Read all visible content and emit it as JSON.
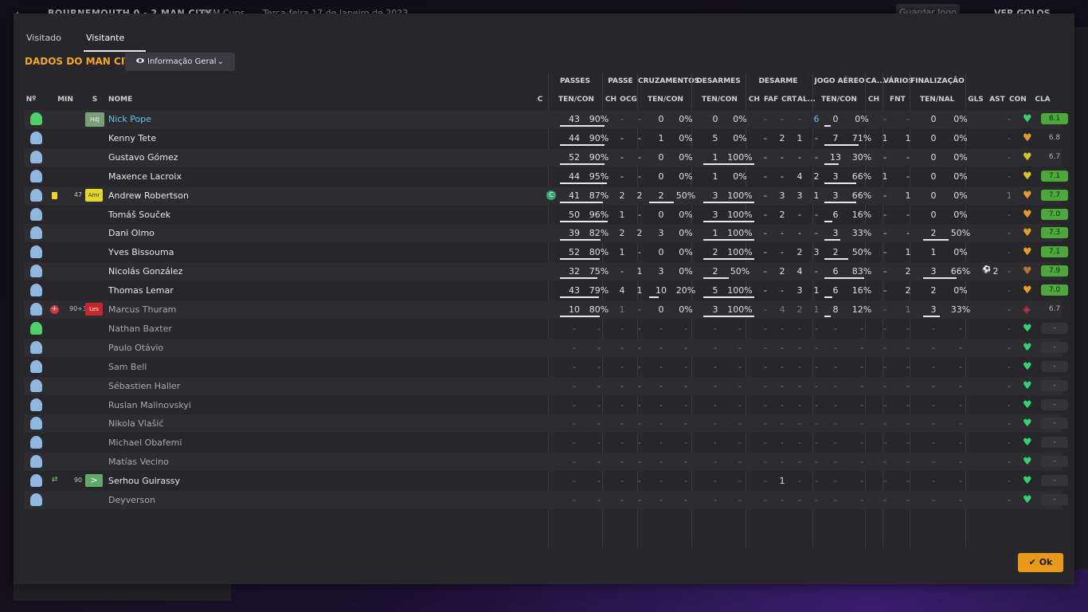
{
  "topbar": {
    "score": "BOURNEMOUTH  0 - 2  MAN CITY",
    "competition": "LMFM Cups",
    "date": "Terça-feira 17 de Janeiro de 2023",
    "save_label": "Guardar Jogo",
    "goals_label": "VER GOLOS"
  },
  "tabs": [
    "Visitado",
    "Visitante"
  ],
  "section_title": "DADOS DO MAN CITY",
  "view_selector": "Informação Geral",
  "group_headers": [
    "PASSES",
    "PASSE",
    "CRUZAMENTOS",
    "DESARMES",
    "DESARME",
    "JOGO AÉREO",
    "CA...",
    "VÁRIOS",
    "FINALIZAÇÃO"
  ],
  "column_headers": {
    "no": "Nº",
    "min": "MIN",
    "s": "S",
    "name": "NOME",
    "c": "C",
    "passes": "TEN/CON",
    "ch": "CH",
    "ocg": "OCG",
    "crosses": "TEN/CON",
    "tackles": "TEN/CON",
    "t_ch": "CH",
    "faf": "FAF",
    "crt": "CRT",
    "al": "AL...",
    "aerial": "TEN/CON",
    "ca_ch": "CH",
    "fnt": "FNT",
    "finish": "TEN/NAL",
    "gls": "GLS",
    "ast": "AST",
    "con": "CON",
    "cla": "CLA"
  },
  "ok_label": "Ok",
  "colors": {
    "accent": "#f4a628",
    "rating_green": "#4ea73a",
    "heart_green": "#35d46a",
    "heart_orange": "#e79a2e"
  },
  "players": [
    {
      "name": "Nick Pope",
      "gk": true,
      "pos": "HdJ",
      "pos_style": "gk",
      "min": "",
      "p": [
        "43",
        "90%"
      ],
      "pb": 0.9,
      "pch": "-",
      "ocg": "-",
      "dim": true,
      "cr": [
        "0",
        "0%"
      ],
      "crb": 0,
      "ds": [
        "0",
        "0%"
      ],
      "dsb": 0,
      "t": [
        "-",
        "-",
        "-",
        "6"
      ],
      "tdim": true,
      "ae": [
        "0",
        "0%"
      ],
      "aeb": 0,
      "ca": "-",
      "fnt": "-",
      "fi": [
        "0",
        "0%"
      ],
      "fib": 0,
      "gls": "",
      "ast": "-",
      "con": "green",
      "cla": "8.1",
      "cla_style": "green"
    },
    {
      "name": "Kenny Tete",
      "pos": "",
      "min": "",
      "p": [
        "44",
        "90%"
      ],
      "pb": 0.9,
      "pch": "-",
      "ocg": "-",
      "cr": [
        "1",
        "0%"
      ],
      "crb": 0,
      "ds": [
        "5",
        "0%"
      ],
      "dsb": 0,
      "t": [
        "-",
        "2",
        "1",
        "-"
      ],
      "ae": [
        "7",
        "71%"
      ],
      "aeb": 0.71,
      "ca": "1",
      "fnt": "1",
      "fi": [
        "0",
        "0%"
      ],
      "fib": 0,
      "gls": "",
      "ast": "-",
      "con": "orange",
      "cla": "6.8",
      "cla_style": "plain"
    },
    {
      "name": "Gustavo Gómez",
      "pos": "",
      "min": "",
      "p": [
        "52",
        "90%"
      ],
      "pb": 0.9,
      "pch": "-",
      "ocg": "-",
      "cr": [
        "0",
        "0%"
      ],
      "crb": 0,
      "ds": [
        "1",
        "100%"
      ],
      "dsb": 1,
      "t": [
        "-",
        "-",
        "-",
        "-"
      ],
      "ae": [
        "13",
        "30%"
      ],
      "aeb": 0.3,
      "ca": "-",
      "fnt": "-",
      "fi": [
        "0",
        "0%"
      ],
      "fib": 0,
      "gls": "",
      "ast": "-",
      "con": "yellow",
      "cla": "6.7",
      "cla_style": "plain"
    },
    {
      "name": "Maxence Lacroix",
      "pos": "",
      "min": "",
      "p": [
        "44",
        "95%"
      ],
      "pb": 0.95,
      "pch": "-",
      "ocg": "-",
      "cr": [
        "0",
        "0%"
      ],
      "crb": 0,
      "ds": [
        "1",
        "0%"
      ],
      "dsb": 0,
      "t": [
        "-",
        "-",
        "4",
        "2"
      ],
      "ae": [
        "3",
        "66%"
      ],
      "aeb": 0.66,
      "ca": "1",
      "fnt": "-",
      "fi": [
        "0",
        "0%"
      ],
      "fib": 0,
      "gls": "",
      "ast": "-",
      "con": "yellow",
      "cla": "7.1",
      "cla_style": "green"
    },
    {
      "name": "Andrew Robertson",
      "pos": "Amr",
      "pos_style": "amr",
      "yellow": true,
      "min": "47",
      "cap": true,
      "p": [
        "41",
        "87%"
      ],
      "pb": 0.87,
      "pch": "2",
      "ocg": "2",
      "cr": [
        "2",
        "50%"
      ],
      "crb": 0.5,
      "ds": [
        "3",
        "100%"
      ],
      "dsb": 1,
      "t": [
        "-",
        "3",
        "3",
        "1"
      ],
      "ae": [
        "3",
        "66%"
      ],
      "aeb": 0.66,
      "ca": "-",
      "fnt": "1",
      "fi": [
        "0",
        "0%"
      ],
      "fib": 0,
      "gls": "",
      "ast": "1",
      "con": "orange",
      "cla": "7.7",
      "cla_style": "green"
    },
    {
      "name": "Tomáš Souček",
      "pos": "",
      "min": "",
      "p": [
        "50",
        "96%"
      ],
      "pb": 0.96,
      "pch": "1",
      "ocg": "-",
      "cr": [
        "0",
        "0%"
      ],
      "crb": 0,
      "ds": [
        "3",
        "100%"
      ],
      "dsb": 1,
      "t": [
        "-",
        "2",
        "-",
        "-"
      ],
      "ae": [
        "6",
        "16%"
      ],
      "aeb": 0.16,
      "ca": "-",
      "fnt": "-",
      "fi": [
        "0",
        "0%"
      ],
      "fib": 0,
      "gls": "",
      "ast": "-",
      "con": "orange",
      "cla": "7.0",
      "cla_style": "green"
    },
    {
      "name": "Dani Olmo",
      "pos": "",
      "min": "",
      "p": [
        "39",
        "82%"
      ],
      "pb": 0.82,
      "pch": "2",
      "ocg": "2",
      "cr": [
        "3",
        "0%"
      ],
      "crb": 0,
      "ds": [
        "1",
        "100%"
      ],
      "dsb": 1,
      "t": [
        "-",
        "-",
        "-",
        "-"
      ],
      "ae": [
        "3",
        "33%"
      ],
      "aeb": 0.33,
      "ca": "-",
      "fnt": "-",
      "fi": [
        "2",
        "50%"
      ],
      "fib": 0.5,
      "gls": "",
      "ast": "-",
      "con": "orange",
      "cla": "7.3",
      "cla_style": "green"
    },
    {
      "name": "Yves Bissouma",
      "pos": "",
      "min": "",
      "p": [
        "52",
        "80%"
      ],
      "pb": 0.8,
      "pch": "1",
      "ocg": "-",
      "cr": [
        "0",
        "0%"
      ],
      "crb": 0,
      "ds": [
        "2",
        "100%"
      ],
      "dsb": 1,
      "t": [
        "-",
        "-",
        "2",
        "3"
      ],
      "ae": [
        "2",
        "50%"
      ],
      "aeb": 0.5,
      "ca": "-",
      "fnt": "1",
      "fi": [
        "1",
        "0%"
      ],
      "fib": 0,
      "gls": "",
      "ast": "-",
      "con": "orange",
      "cla": "7.1",
      "cla_style": "green"
    },
    {
      "name": "Nicolás González",
      "pos": "",
      "min": "",
      "p": [
        "32",
        "75%"
      ],
      "pb": 0.75,
      "pch": "-",
      "ocg": "1",
      "cr": [
        "3",
        "0%"
      ],
      "crb": 0,
      "ds": [
        "2",
        "50%"
      ],
      "dsb": 0.5,
      "t": [
        "-",
        "2",
        "4",
        "-"
      ],
      "ae": [
        "6",
        "83%"
      ],
      "aeb": 0.83,
      "ca": "-",
      "fnt": "2",
      "fi": [
        "3",
        "66%"
      ],
      "fib": 0.66,
      "gls": "2",
      "ball": true,
      "ast": "-",
      "con": "brown",
      "cla": "7.9",
      "cla_style": "green"
    },
    {
      "name": "Thomas Lemar",
      "pos": "",
      "min": "",
      "p": [
        "43",
        "79%"
      ],
      "pb": 0.79,
      "pch": "4",
      "ocg": "1",
      "cr": [
        "10",
        "20%"
      ],
      "crb": 0.2,
      "ds": [
        "5",
        "100%"
      ],
      "dsb": 1,
      "t": [
        "-",
        "-",
        "3",
        "1"
      ],
      "ae": [
        "6",
        "16%"
      ],
      "aeb": 0.16,
      "ca": "-",
      "fnt": "2",
      "fi": [
        "2",
        "0%"
      ],
      "fib": 0,
      "gls": "",
      "ast": "-",
      "con": "orange",
      "cla": "7.0",
      "cla_style": "green"
    },
    {
      "name": "Marcus Thuram",
      "muted": true,
      "pos": "Les",
      "pos_style": "les",
      "injury": true,
      "min": "90+3",
      "p": [
        "10",
        "80%"
      ],
      "pb": 0.8,
      "pch": "1",
      "ocg": "-",
      "dim": true,
      "cr": [
        "0",
        "0%"
      ],
      "crb": 0,
      "ds": [
        "3",
        "100%"
      ],
      "dsb": 1,
      "t": [
        "-",
        "4",
        "2",
        "1"
      ],
      "tdim": true,
      "ae": [
        "8",
        "12%"
      ],
      "aeb": 0.12,
      "ca": "-",
      "fnt": "1",
      "fi": [
        "3",
        "33%"
      ],
      "fib": 0.33,
      "gls": "",
      "ast": "-",
      "con": "red",
      "cla": "6.7",
      "cla_style": "plain"
    },
    {
      "name": "Nathan Baxter",
      "muted": true,
      "gkshirt": true,
      "empty": true
    },
    {
      "name": "Paulo Otávio",
      "muted": true,
      "empty": true
    },
    {
      "name": "Sam Bell",
      "muted": true,
      "empty": true
    },
    {
      "name": "Sébastien Haller",
      "muted": true,
      "empty": true
    },
    {
      "name": "Ruslan Malinovskyi",
      "muted": true,
      "empty": true
    },
    {
      "name": "Nikola Vlašić",
      "muted": true,
      "empty": true
    },
    {
      "name": "Michael Obafemi",
      "muted": true,
      "empty": true
    },
    {
      "name": "Matías Vecino",
      "muted": true,
      "empty": true
    },
    {
      "name": "Serhou Guirassy",
      "pos": ">",
      "pos_style": "sub",
      "sub": true,
      "min": "90",
      "empty": true,
      "t_override": [
        "-",
        "1",
        "-",
        "-"
      ]
    },
    {
      "name": "Deyverson",
      "muted": true,
      "empty": true
    }
  ]
}
